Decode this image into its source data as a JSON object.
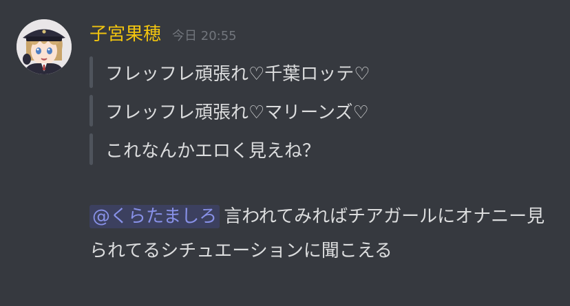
{
  "message": {
    "author": "子宮果穂",
    "timestamp": "今日 20:55",
    "quotes": [
      "フレッフレ頑張れ♡千葉ロッテ♡",
      "フレッフレ頑張れ♡マリーンズ♡",
      "これなんかエロく見えね？"
    ],
    "mention": "@くらたましろ",
    "reply_text": "言われてみればチアガールにオナニー見られてるシチュエーションに聞こえる"
  },
  "colors": {
    "background": "#36393f",
    "username": "#f1c40f",
    "timestamp": "#72767d",
    "text": "#dcddde",
    "quote_bar": "#4f545c",
    "mention": "#8891e8"
  },
  "icons": {
    "avatar": "anime-character-avatar"
  }
}
